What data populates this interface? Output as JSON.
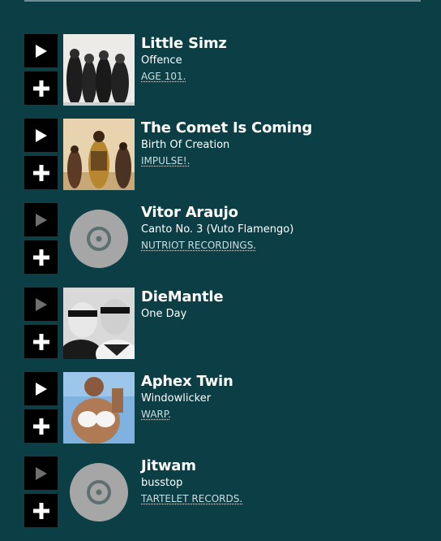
{
  "tracks": [
    {
      "artist": "Little Simz",
      "title": "Offence",
      "label": "AGE 101.",
      "artwork": "band-photo",
      "playable": true
    },
    {
      "artist": "The Comet Is Coming",
      "title": "Birth Of Creation",
      "label": "IMPULSE!.",
      "artwork": "band-photo-warm",
      "playable": true
    },
    {
      "artist": "Vitor Araujo",
      "title": "Canto No. 3 (Vuto Flamengo)",
      "label": "NUTRIOT RECORDINGS.",
      "artwork": "placeholder-disc",
      "playable": false
    },
    {
      "artist": "DieMantle",
      "title": "One Day",
      "label": "",
      "artwork": "duo-photo-bw",
      "playable": false
    },
    {
      "artist": "Aphex Twin",
      "title": "Windowlicker",
      "label": "WARP.",
      "artwork": "cover-photo-blue",
      "playable": true
    },
    {
      "artist": "Jitwam",
      "title": "busstop",
      "label": "TARTELET RECORDS.",
      "artwork": "placeholder-disc",
      "playable": false
    }
  ],
  "icons": {
    "play": "play-icon",
    "add": "plus-icon",
    "placeholder": "disc-icon"
  },
  "colors": {
    "background": "#0b3e45",
    "button": "#000000",
    "play_enabled": "#ffffff",
    "play_disabled": "#6f6f6f"
  }
}
